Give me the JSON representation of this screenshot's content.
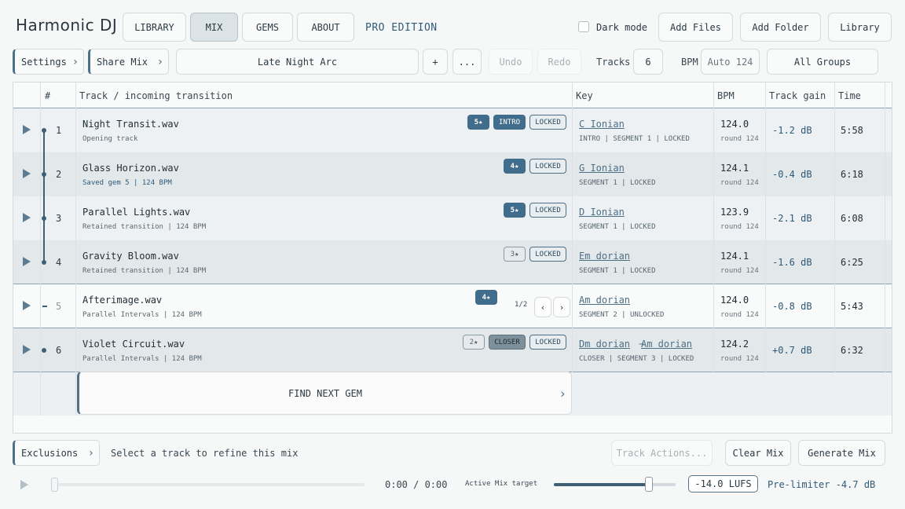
{
  "app": {
    "title": "Harmonic DJ",
    "edition": "PRO EDITION"
  },
  "nav": {
    "tabs": [
      "LIBRARY",
      "MIX",
      "GEMS",
      "ABOUT"
    ],
    "active": "MIX"
  },
  "header_right": {
    "dark_mode_label": "Dark mode",
    "dark_mode": false,
    "add_files": "Add Files",
    "add_folder": "Add Folder",
    "library": "Library"
  },
  "toolbar": {
    "settings": "Settings",
    "share_mix": "Share Mix",
    "mix_name": "Late Night Arc",
    "plus": "+",
    "more": "...",
    "undo": "Undo",
    "redo": "Redo",
    "tracks_label": "Tracks",
    "tracks_count": "6",
    "bpm_label": "BPM",
    "bpm_value": "Auto 124",
    "groups": "All Groups"
  },
  "table": {
    "headers": {
      "num": "#",
      "track": "Track / incoming transition",
      "key": "Key",
      "bpm": "BPM",
      "gain": "Track gain",
      "time": "Time"
    },
    "rows": [
      {
        "num": "1",
        "name": "Night Transit.wav",
        "sub": "Opening track",
        "stars": "5★",
        "tag": "INTRO",
        "lock": "LOCKED",
        "key": "C Ionian",
        "key2": "",
        "key_sub": "INTRO | SEGMENT 1 | LOCKED",
        "bpm": "124.0",
        "bpm_sub": "round 124",
        "gain": "-1.2 dB",
        "time": "5:58"
      },
      {
        "num": "2",
        "name": "Glass Horizon.wav",
        "sub": "Saved gem 5 | 124 BPM",
        "stars": "4★",
        "tag": "",
        "lock": "LOCKED",
        "key": "G Ionian",
        "key2": "",
        "key_sub": "SEGMENT 1 | LOCKED",
        "bpm": "124.1",
        "bpm_sub": "round 124",
        "gain": "-0.4 dB",
        "time": "6:18"
      },
      {
        "num": "3",
        "name": "Parallel Lights.wav",
        "sub": "Retained transition | 124 BPM",
        "stars": "5★",
        "tag": "",
        "lock": "LOCKED",
        "key": "D Ionian",
        "key2": "",
        "key_sub": "SEGMENT 1 | LOCKED",
        "bpm": "123.9",
        "bpm_sub": "round 124",
        "gain": "-2.1 dB",
        "time": "6:08"
      },
      {
        "num": "4",
        "name": "Gravity Bloom.wav",
        "sub": "Retained transition | 124 BPM",
        "stars": "3★",
        "tag": "",
        "lock": "LOCKED",
        "key": "Em dorian",
        "key2": "",
        "key_sub": "SEGMENT 1 | LOCKED",
        "bpm": "124.1",
        "bpm_sub": "round 124",
        "gain": "-1.6 dB",
        "time": "6:25"
      },
      {
        "num": "5",
        "name": "Afterimage.wav",
        "sub": "Parallel Intervals | 124 BPM",
        "stars": "4★",
        "tag": "",
        "lock": "",
        "page": "1/2",
        "prev": "‹",
        "next": "›",
        "key": "Am dorian",
        "key2": "",
        "key_sub": "SEGMENT 2 | UNLOCKED",
        "bpm": "124.0",
        "bpm_sub": "round 124",
        "gain": "-0.8 dB",
        "time": "5:43"
      },
      {
        "num": "6",
        "name": "Violet Circuit.wav",
        "sub": "Parallel Intervals | 124 BPM",
        "stars": "2★",
        "tag": "CLOSER",
        "lock": "LOCKED",
        "key": "Dm dorian",
        "arrow": "→",
        "key2": "Am dorian",
        "key_sub": "CLOSER | SEGMENT 3 | LOCKED",
        "bpm": "124.2",
        "bpm_sub": "round 124",
        "gain": "+0.7 dB",
        "time": "6:32"
      }
    ],
    "find_next": "FIND NEXT GEM"
  },
  "footer": {
    "exclusions": "Exclusions",
    "hint": "Select a track to refine this mix",
    "track_actions": "Track Actions...",
    "clear_mix": "Clear Mix",
    "generate_mix": "Generate Mix",
    "time": "0:00 / 0:00",
    "target_label": "Active Mix target",
    "target_level": 0.78,
    "lufs": "-14.0 LUFS",
    "prelimiter": "Pre-limiter -4.7 dB"
  },
  "colors": {
    "accent": "#3f6d8b",
    "shaded_row": "#e3e8eb",
    "text": "#2c3a44"
  }
}
